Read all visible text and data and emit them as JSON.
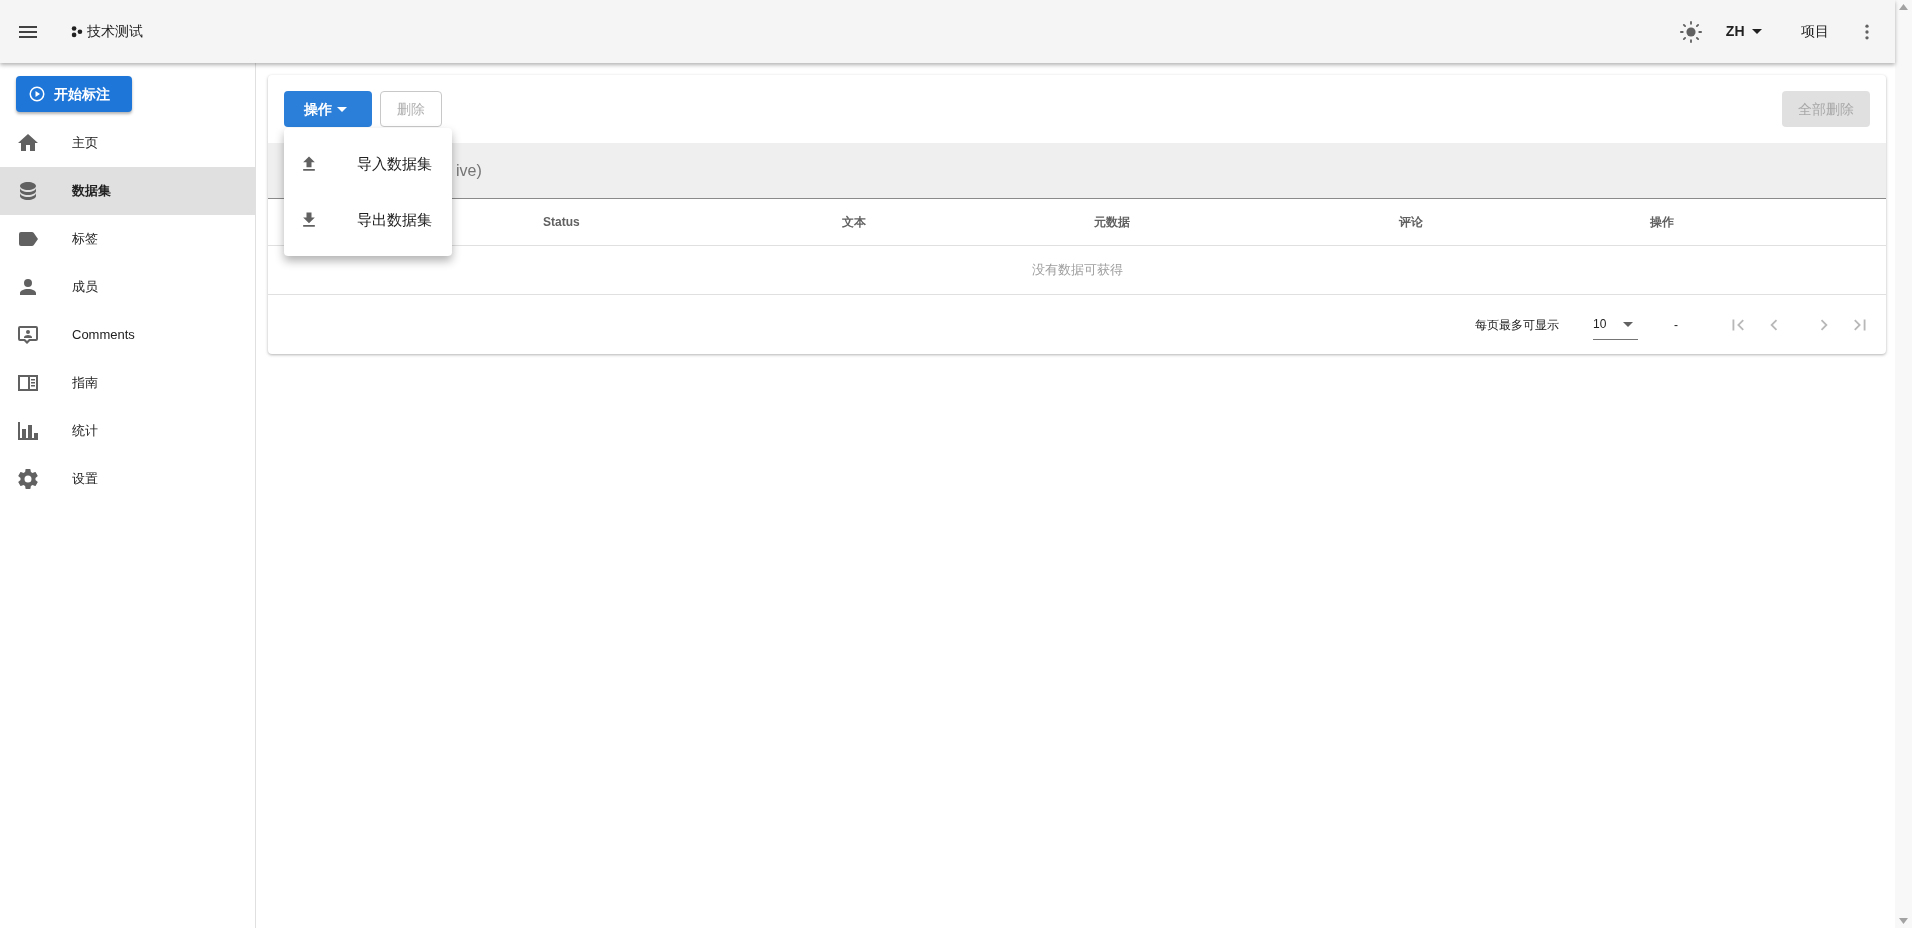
{
  "header": {
    "title": "技术测试",
    "language": "ZH",
    "projects_link": "项目"
  },
  "sidebar": {
    "start_button": "开始标注",
    "items": [
      {
        "label": "主页",
        "selected": false
      },
      {
        "label": "数据集",
        "selected": true
      },
      {
        "label": "标签",
        "selected": false
      },
      {
        "label": "成员",
        "selected": false
      },
      {
        "label": "Comments",
        "selected": false
      },
      {
        "label": "指南",
        "selected": false
      },
      {
        "label": "统计",
        "selected": false
      },
      {
        "label": "设置",
        "selected": false
      }
    ]
  },
  "toolbar": {
    "actions_button": "操作",
    "delete_button": {
      "label": "删除",
      "disabled": true
    },
    "delete_all_button": {
      "label": "全部删除",
      "disabled": true
    }
  },
  "actions_menu": {
    "items": [
      {
        "label": "导入数据集"
      },
      {
        "label": "导出数据集"
      }
    ]
  },
  "search_bar": {
    "visible_text": "ive)"
  },
  "table": {
    "columns": [
      "Status",
      "文本",
      "元数据",
      "评论",
      "操作"
    ],
    "empty_text": "没有数据可获得"
  },
  "pagination": {
    "rows_per_page_label": "每页最多可显示",
    "rows_per_page": "10",
    "range": "-"
  }
}
